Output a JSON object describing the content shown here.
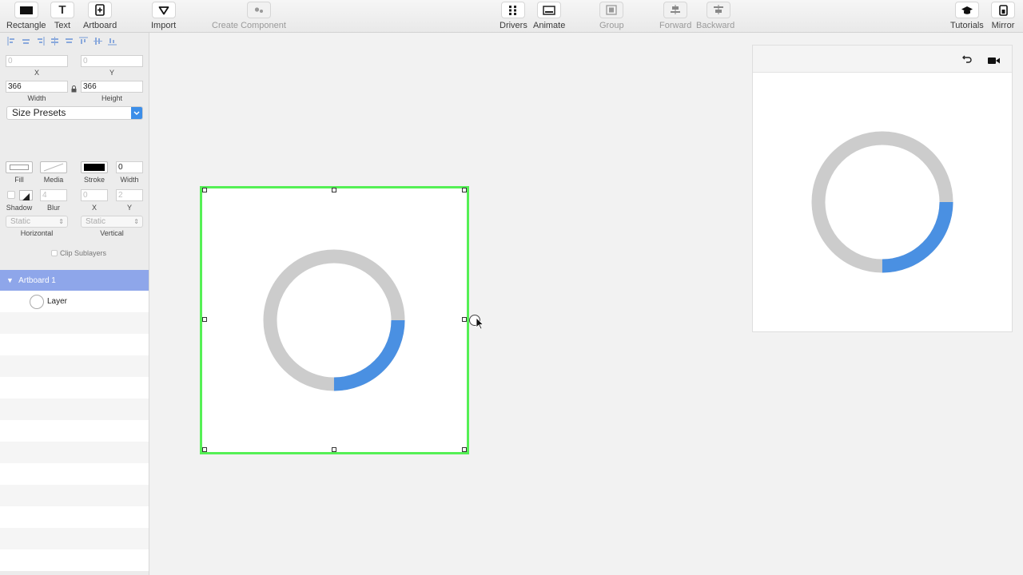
{
  "toolbar": {
    "rectangle": "Rectangle",
    "text": "Text",
    "artboard": "Artboard",
    "import": "Import",
    "create_component": "Create Component",
    "drivers": "Drivers",
    "animate": "Animate",
    "group": "Group",
    "forward": "Forward",
    "backward": "Backward",
    "tutorials": "Tutorials",
    "mirror": "Mirror"
  },
  "inspector": {
    "x_value": "0",
    "y_value": "0",
    "x_label": "X",
    "y_label": "Y",
    "width_value": "366",
    "height_value": "366",
    "width_label": "Width",
    "height_label": "Height",
    "size_presets": "Size Presets",
    "fill_label": "Fill",
    "media_label": "Media",
    "stroke_label": "Stroke",
    "stroke_width_value": "0",
    "stroke_width_label": "Width",
    "shadow_label": "Shadow",
    "blur_value": "4",
    "blur_label": "Blur",
    "shadow_x_value": "0",
    "shadow_y_value": "2",
    "shadow_x_label": "X",
    "shadow_y_label": "Y",
    "horizontal_value": "Static",
    "vertical_value": "Static",
    "horizontal_label": "Horizontal",
    "vertical_label": "Vertical",
    "clip_sublayers": "Clip Sublayers"
  },
  "layers": {
    "artboard": "Artboard 1",
    "layer": "Layer"
  },
  "colors": {
    "ring_track": "#cccccc",
    "ring_progress": "#4a90e2",
    "selection": "#55f055",
    "layer_header": "#8ea6ea"
  },
  "progress_ring": {
    "progress_fraction": 0.25
  }
}
